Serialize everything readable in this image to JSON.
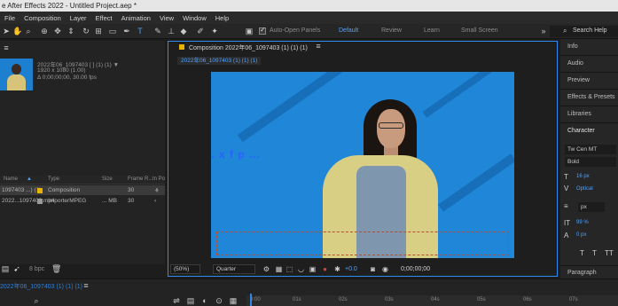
{
  "title": "e After Effects 2022 - Untitled Project.aep *",
  "menu": [
    "File",
    "Composition",
    "Layer",
    "Effect",
    "Animation",
    "View",
    "Window",
    "Help"
  ],
  "toolbar": {
    "auto_open": "Auto-Open Panels",
    "workspaces": [
      "Default",
      "Review",
      "Learn",
      "Small Screen"
    ],
    "active_workspace": "Default",
    "search_placeholder": "Search Help"
  },
  "project": {
    "comp_name": "2022年06_1097403 [ ] (1) (1) ▼",
    "meta": [
      "1920 x 1080 (1.00)",
      "Δ 0;00;00;00, 30.00 fps"
    ],
    "columns": [
      "Name",
      "Type",
      "Size",
      "Frame R...",
      "In Po"
    ],
    "rows": [
      {
        "name": "1097403 ...) (1)",
        "type": "Composition",
        "size": "",
        "fps": "30",
        "color": "#e6b400"
      },
      {
        "name": "2022...1097403.mp4",
        "type": "ImporterMPEG",
        "size": "... MB",
        "fps": "30",
        "color": "#9a9a9a"
      }
    ],
    "footer_bpc": "8 bpc"
  },
  "composition": {
    "tab": "Composition",
    "tab_name": "2022年06_1097403 (1) (1) (1)",
    "sub_tab": "2022年06_1097403 (1) (1) (1)",
    "watermark": "技艺C... x f p ...",
    "zoom": "(50%)",
    "resolution": "Quarter",
    "exposure": "+0.0",
    "timecode": "0;00;00;00"
  },
  "right_panel": {
    "items": [
      "Info",
      "Audio",
      "Preview",
      "Effects & Presets",
      "Libraries"
    ],
    "character_title": "Character",
    "font": "Tw Cen MT",
    "style": "Bold",
    "size_val": "16 px",
    "leading_val": "Optical",
    "tracking_val": "99 %",
    "baseline_val": "0 px",
    "px_label": "px",
    "paragraph": "Paragraph"
  },
  "timeline": {
    "tab": "2022年06_1097403 (1) (1) (1)",
    "ticks": [
      "0:00",
      "01s",
      "02s",
      "03s",
      "04s",
      "05s",
      "06s",
      "07s"
    ]
  },
  "colors": {
    "accent": "#2d8cf0",
    "viewer_bg": "#1f86d8",
    "comp_label": "#e6b400"
  }
}
